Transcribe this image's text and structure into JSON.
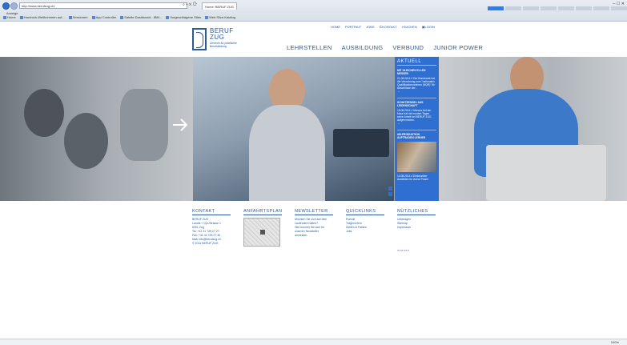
{
  "browser": {
    "address": "http://www.berufzug.ch/",
    "tabs": [
      {
        "label": "Home: BERUF ZUG",
        "active": true
      },
      {
        "label": "",
        "active": false
      },
      {
        "label": "",
        "active": false
      }
    ],
    "menu": "Anzeige",
    "favorites": [
      "Home",
      "Hardrock-Weltkommen auf...",
      "Sessionen",
      "App Controller",
      "Satelle Dashboard - IBM...",
      "Vorgeschlagene Sites",
      "Web Slice-Katalog"
    ],
    "zoom": "100%"
  },
  "site": {
    "logo_name_1": "BERUF",
    "logo_name_2": "ZUG",
    "logo_sub": "Zentrum für praktische Berufsbildung",
    "topnav": [
      "HOME",
      "PORTRAIT",
      "JOBS",
      "KONTAKT",
      "SUCHEN",
      "LOGIN"
    ],
    "mainnav": [
      "LEHRSTELLEN",
      "AUSBILDUNG",
      "VERBUND",
      "JUNIOR POWER"
    ]
  },
  "aktuell": {
    "heading": "AKTUELL",
    "items": [
      {
        "title": "MIT GLEICHEN ELLEN MESSEN",
        "text": "21.08.2014 // Der Bundesrat hat die Verordnung zum \"nationalen Qualifikationsrahmen (NQR)\" für Abschlüsse der...",
        "link": "→"
      },
      {
        "title": "SCHUTZENGEL AUS LEIDENSCHAFT",
        "text": "18.08.2014 // Marcus Auf der Maur hat mit hundert Tagen seine Arbeit bei BERUF ZUG aufgenommen.",
        "link": "→"
      },
      {
        "title": "AB-PRODUKTION AUFTRAGEN LERNEN",
        "text": "14.08.2014 // Elektroniker Ausbilden im Junior Power",
        "link": ""
      }
    ]
  },
  "footer": {
    "kontakt": {
      "heading": "KONTAKT",
      "lines": [
        "BERUF ZUG",
        "Landis + Gyr-Strasse 1",
        "6301 Zug",
        "Tel. +41 41 728 27 27",
        "Fax: +41 41 728 27 30",
        "Mail: info@berufzug.ch",
        "© 2014 BERUF ZUG"
      ]
    },
    "anfahrt": {
      "heading": "ANFAHRTSPLAN"
    },
    "newsletter": {
      "heading": "NEWSLETTER",
      "lines": [
        "Möchten Sie sich auf dem",
        "Laufenden halten?",
        "Hier können Sie sich für",
        "unseren Newsletter",
        "anmelden."
      ]
    },
    "quicklinks": {
      "heading": "QUICKLINKS",
      "lines": [
        "Portrait",
        "Trägerverein",
        "Zahlen & Fakten",
        "Jobs"
      ]
    },
    "nuetzliches": {
      "heading": "NÜTZLICHES",
      "lines": [
        "Unterlagen",
        "Sitemap",
        "Impressum"
      ]
    },
    "dots": "»»»»»»"
  }
}
